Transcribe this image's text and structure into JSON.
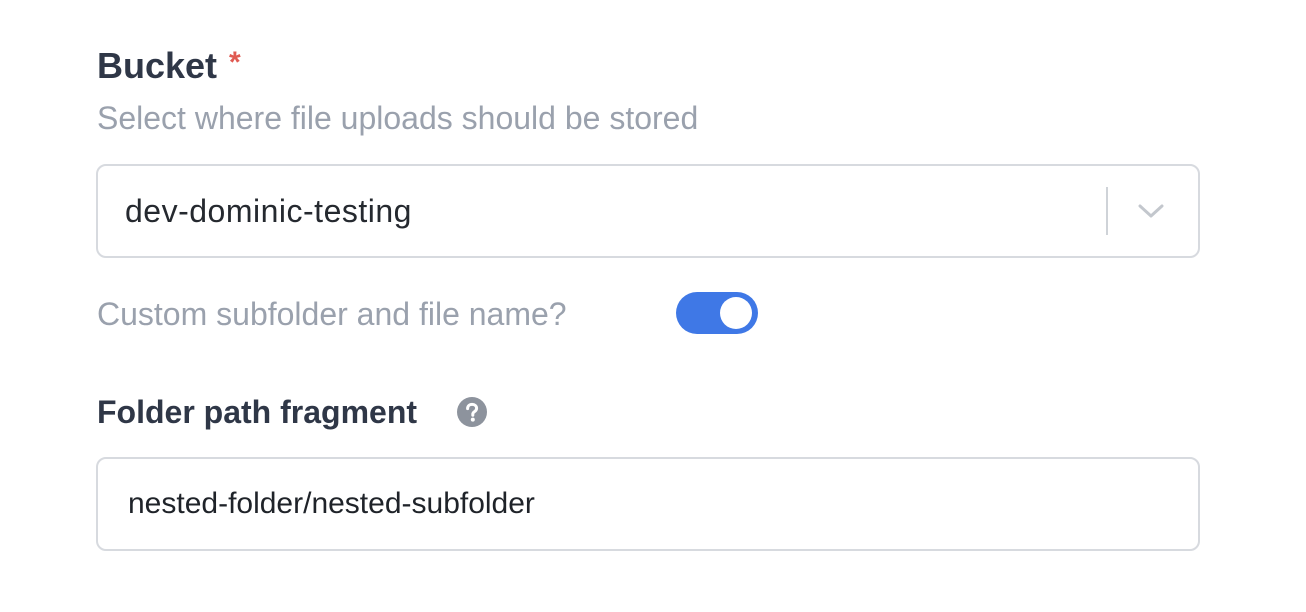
{
  "bucket": {
    "label": "Bucket",
    "required_mark": "*",
    "description": "Select where file uploads should be stored",
    "selected_value": "dev-dominic-testing",
    "dropdown_icon": "chevron-down-icon"
  },
  "custom_path": {
    "label": "Custom subfolder and file name?",
    "enabled": true
  },
  "folder_path": {
    "label": "Folder path fragment",
    "help_icon": "question-circle-icon",
    "value": "nested-folder/nested-subfolder"
  },
  "colors": {
    "toggle_on": "#3f78e6",
    "required": "#e05a52",
    "label_text": "#2f3747",
    "muted_text": "#9aa1ad"
  }
}
